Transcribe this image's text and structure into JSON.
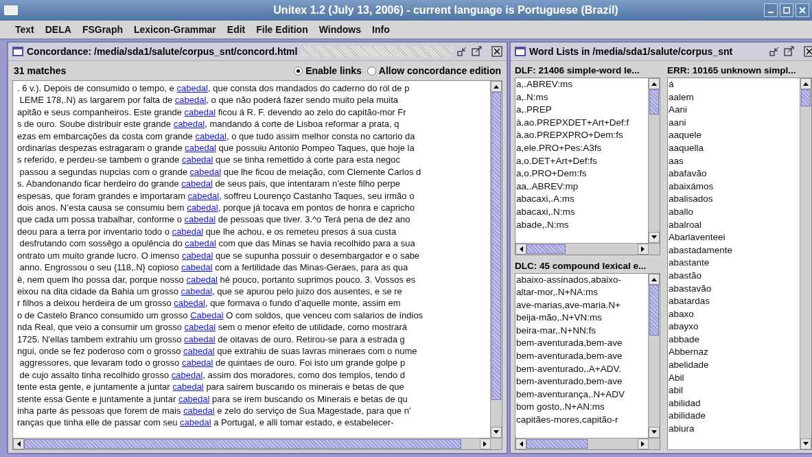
{
  "window": {
    "title": "Unitex 1.2 (July 13, 2006) - current language is Portuguese (Brazil)"
  },
  "menu": [
    {
      "label": "Text"
    },
    {
      "label": "DELA"
    },
    {
      "label": "FSGraph"
    },
    {
      "label": "Lexicon-Grammar"
    },
    {
      "label": "Edit"
    },
    {
      "label": "File Edition"
    },
    {
      "label": "Windows"
    },
    {
      "label": "Info"
    }
  ],
  "concordance": {
    "title": "Concordance: /media/sda1/salute/corpus_snt/concord.html",
    "matches": "31 matches",
    "options": [
      {
        "label": "Enable links",
        "selected": true
      },
      {
        "label": "Allow concordance edition",
        "selected": false
      }
    ],
    "lines": [
      {
        "left": ". 6 v.). Depois de consumido o tempo, e ",
        "match": "cabedal",
        "right": ", que consta dos mandados do caderno do ról de p"
      },
      {
        "left": " LEME 178,.N) as largarem por falta de ",
        "match": "cabedal",
        "right": ", o que não poderá fazer sendo muito pela muita"
      },
      {
        "left": "apitão e seus companheiros. Este grande ",
        "match": "cabedal",
        "right": " ficou á R. F. devendo ao zelo do capitão-mor Fr"
      },
      {
        "left": "s de ouro. Soube distribuir este grande ",
        "match": "cabedal",
        "right": ", mandando á corte de Lisboa reformar a prata, q"
      },
      {
        "left": "ezas em embarcações da costa com grande ",
        "match": "cabedal",
        "right": ", o que tudo assim melhor consta no cartorio da"
      },
      {
        "left": "ordinarias despezas estragaram o grande ",
        "match": "cabedal",
        "right": " que possuiu Antonio Pompeo Taques, que hoje la"
      },
      {
        "left": "s referido, e perdeu-se tambem o grande ",
        "match": "cabedal",
        "right": " que se tinha remettido á corte para esta negoc"
      },
      {
        "left": " passou a segundas nupcias com o grande ",
        "match": "cabedal",
        "right": " que lhe ficou de meiação, com Clemente Carlos d"
      },
      {
        "left": "s. Abandonando ficar herdeiro do grande ",
        "match": "cabedal",
        "right": " de seus pais, que intentaram n’este filho perpe"
      },
      {
        "left": "espesas, que foram grandes e importaram ",
        "match": "cabedal",
        "right": ", soffreu Lourenço Castanho Taques, seu irmão o"
      },
      {
        "left": "dois anos. N’esta causa se consumiu bem ",
        "match": "cabedal",
        "right": ", porque já tocava em pontos de honra e capricho"
      },
      {
        "left": "que cada um possa trabalhar, conforme o ",
        "match": "cabedal",
        "right": " de pessoas que tiver. 3.^o Terá pena de dez ano"
      },
      {
        "left": "deou para a terra por inventario todo o ",
        "match": "cabedal",
        "right": " que lhe achou, e os remeteu presos á sua custa"
      },
      {
        "left": " desfrutando com sossêgo a opulência do ",
        "match": "cabedal",
        "right": " com que das Minas se havia recolhido para a sua"
      },
      {
        "left": "ontrato um muito grande lucro. O imenso ",
        "match": "cabedal",
        "right": " que se supunha possuir o desembargador e o sabe"
      },
      {
        "left": " anno. Engrossou o seu {118,.N} copioso ",
        "match": "cabedal",
        "right": " com a fertilidade das Minas-Geraes, para as qua"
      },
      {
        "left": "ê, nem quem lho possa dar, porque nosso ",
        "match": "cabedal",
        "right": " hé pouco, portanto suprimos pouco. 3. Vossos es"
      },
      {
        "left": "eixou na dita cidade da Bahia um grosso ",
        "match": "cabedal",
        "right": ", que se apurou pelo juizo dos ausentes, e se re"
      },
      {
        "left": "r filhos a deixou herdeira de um grosso ",
        "match": "cabedal",
        "right": ", que formava o fundo d’aquelle monte, assim em"
      },
      {
        "left": "o de Castelo Branco consumido um grosso ",
        "match": "Cabedal",
        "right": " O com soldos, que venceu com salarios de índios"
      },
      {
        "left": "nda Real, que veio a consumir um grosso ",
        "match": "cabedal",
        "right": " sem o menor efeito de utilidade, como mostrará"
      },
      {
        "left": "1725. N'ellas tambem extrahiu um grosso ",
        "match": "cabedal",
        "right": " de oitavas de ouro. Retirou-se para a estrada g"
      },
      {
        "left": "ngui, onde se fez poderoso com o grosso ",
        "match": "cabedal",
        "right": " que extrahiu de suas lavras mineraes com o nume"
      },
      {
        "left": " aggressores, que levaram todo o grosso ",
        "match": "cabedal",
        "right": " de quintaes de ouro. Foi isto um grande golpe p"
      },
      {
        "left": " de cujo assalto tinha recolhido grosso ",
        "match": "cabedal",
        "right": ", assim dos moradores, como dos templos, tendo d"
      },
      {
        "left": "tente esta gente, e juntamente a juntar ",
        "match": "cabedal",
        "right": " para sairem buscando os minerais e betas de que"
      },
      {
        "left": "stente essa Gente e juntamente a juntar ",
        "match": "cabedal",
        "right": " para se irem buscando os Minerais e betas de qu"
      },
      {
        "left": "inha parte ás pessoas que forem de mais ",
        "match": "cabedal",
        "right": " e zelo do serviço de Sua Magestade, para que n'"
      },
      {
        "left": "ranças que tinha elle de passar com seu ",
        "match": "cabedal",
        "right": " a Portugal, e alli tomar estado, e estabelecer-"
      }
    ]
  },
  "word_lists": {
    "title": "Word Lists in /media/sda1/salute/corpus_snt",
    "dlf": {
      "heading": "DLF: 21406 simple-word le...",
      "items": [
        "a,.ABREV:ms",
        "a,.N:ms",
        "a,.PREP",
        "à,ao.PREPXDET+Art+Def:f",
        "à,ao.PREPXPRO+Dem:fs",
        "a,ele.PRO+Pes:A3fs",
        "a,o.DET+Art+Def:fs",
        "a,o.PRO+Dem:fs",
        "aa,.ABREV:mp",
        "abacaxi,.A:ms",
        "abacaxi,.N:ms",
        "abade,.N:ms"
      ]
    },
    "dlc": {
      "heading": "DLC: 45 compound lexical e...",
      "items": [
        "abaixo-assinados,abaixo-",
        "altar-mor,.N+NA:ms",
        "ave-marias,ave-maria.N+",
        "beija-mão,.N+VN:ms",
        "beira-mar,.N+NN:fs",
        "bem-aventurada,bem-ave",
        "bem-aventurada,bem-ave",
        "bem-aventurado,.A+ADV.",
        "bem-aventurado,bem-ave",
        "bem-aventurança,.N+ADV",
        "bom gosto,.N+AN:ms",
        "capitães-mores,capitão-r"
      ]
    },
    "err": {
      "heading": "ERR: 10165 unknown simpl...",
      "items": [
        "á",
        "aalem",
        "Aani",
        "aani",
        "aaquele",
        "aaquella",
        "aas",
        "abafavão",
        "abaixámos",
        "abalisados",
        "aballo",
        "abalroal",
        "Abarlaventeei",
        "abastadamente",
        "abastante",
        "abastão",
        "abastavão",
        "abatardas",
        "abaxo",
        "abayxo",
        "abbade",
        "Abbernaz",
        "abelidade",
        "Abil",
        "abil",
        "abilidad",
        "abilidade",
        "abiura"
      ]
    }
  }
}
